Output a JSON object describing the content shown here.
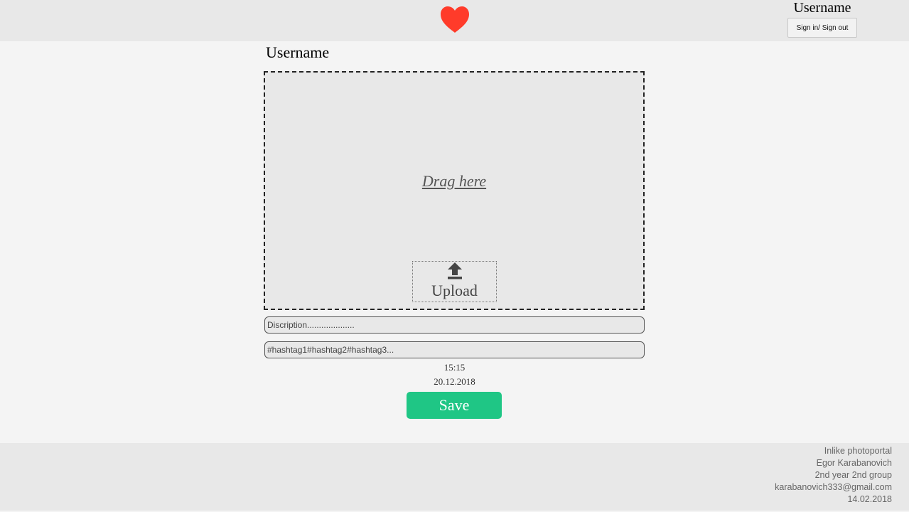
{
  "header": {
    "logo_icon": "heart-icon",
    "logo_color": "#ff3b2a",
    "username": "Username",
    "sign_button_label": "Sign in/ Sign out"
  },
  "main": {
    "username": "Username",
    "dropzone": {
      "drag_text": "Drag here",
      "upload_icon": "upload-icon",
      "upload_label": "Upload"
    },
    "description_placeholder": "Discription....................",
    "hashtags_placeholder": "#hashtag1#hashtag2#hashtag3...",
    "time": "15:15",
    "date": "20.12.2018",
    "save_label": "Save",
    "accent_color": "#1fc685"
  },
  "footer": {
    "lines": [
      "Inlike photoportal",
      "Egor Karabanovich",
      "2nd year 2nd group",
      "karabanovich333@gmail.com",
      "14.02.2018"
    ]
  }
}
